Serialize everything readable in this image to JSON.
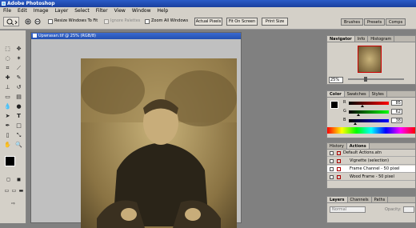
{
  "app": {
    "title": "Adobe Photoshop"
  },
  "menu": [
    "File",
    "Edit",
    "Image",
    "Layer",
    "Select",
    "Filter",
    "View",
    "Window",
    "Help"
  ],
  "options": {
    "resize_windows": "Resize Windows To Fit",
    "ignore_palettes": "Ignore Palettes",
    "zoom_all_windows": "Zoom All Windows",
    "actual_pixels": "Actual Pixels",
    "fit_on_screen": "Fit On Screen",
    "print_size": "Print Size",
    "well_tabs": [
      "Brushes",
      "Presets",
      "Comps"
    ]
  },
  "document": {
    "title": "Upwrasan.tif @ 25% (RGB/8)"
  },
  "navigator": {
    "tabs": [
      "Navigator",
      "Info",
      "Histogram"
    ],
    "zoom": "25%"
  },
  "color": {
    "tabs": [
      "Color",
      "Swatches",
      "Styles"
    ],
    "labels": [
      "R",
      "G",
      "B"
    ],
    "values": [
      "85",
      "62",
      "38"
    ],
    "fill": {
      "R": 0.33,
      "G": 0.24,
      "B": 0.15
    }
  },
  "actions": {
    "tabs": [
      "History",
      "Actions"
    ],
    "rows": [
      "Default Actions.atn",
      "Vignette (selection)",
      "Frame Channel - 50 pixel",
      "Wood Frame - 50 pixel"
    ]
  },
  "layers": {
    "tabs": [
      "Layers",
      "Channels",
      "Paths"
    ],
    "mode": "Normal",
    "opacity_label": "Opacity:"
  }
}
